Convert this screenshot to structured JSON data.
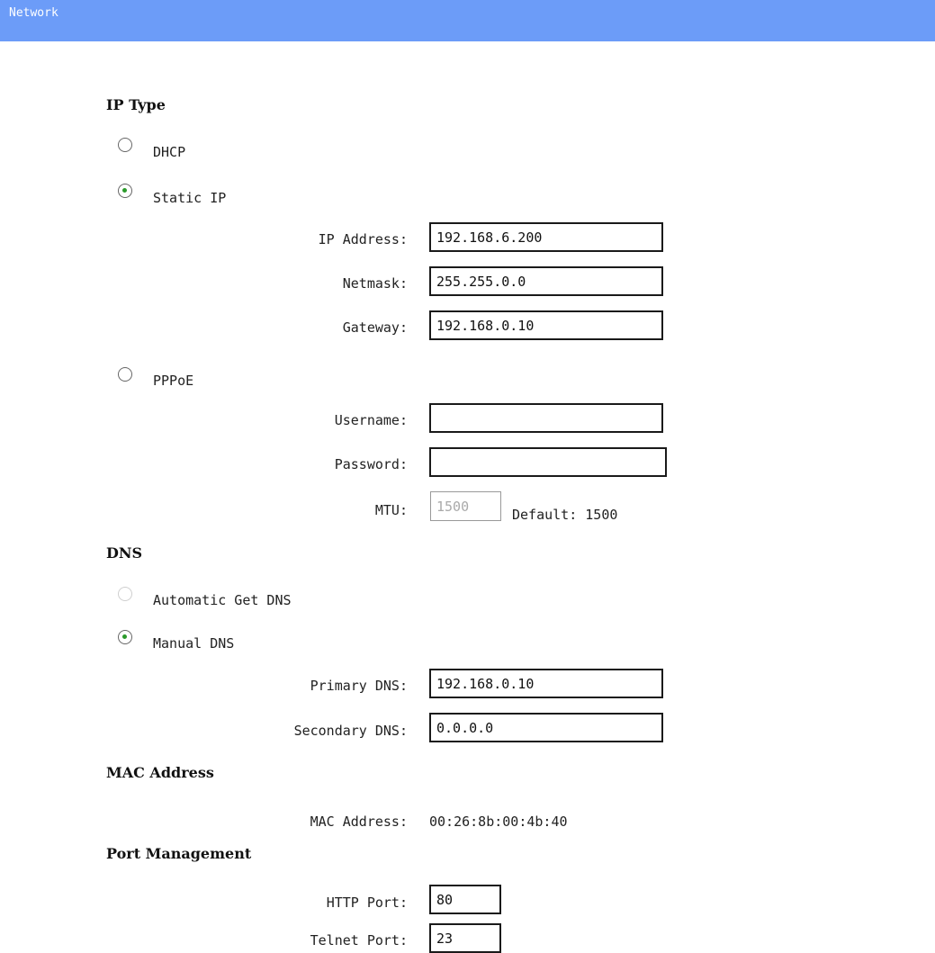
{
  "header": {
    "title": "Network"
  },
  "ip_type": {
    "heading": "IP Type",
    "dhcp": {
      "label": "DHCP",
      "checked": false
    },
    "static_ip": {
      "label": "Static IP",
      "checked": true,
      "ip_address": {
        "label": "IP Address:",
        "value": "192.168.6.200"
      },
      "netmask": {
        "label": "Netmask:",
        "value": "255.255.0.0"
      },
      "gateway": {
        "label": "Gateway:",
        "value": "192.168.0.10"
      }
    },
    "pppoe": {
      "label": "PPPoE",
      "checked": false,
      "username": {
        "label": "Username:",
        "value": ""
      },
      "password": {
        "label": "Password:",
        "value": ""
      },
      "mtu": {
        "label": "MTU:",
        "value": "1500",
        "default_text": "Default: 1500"
      }
    }
  },
  "dns": {
    "heading": "DNS",
    "automatic": {
      "label": "Automatic Get DNS",
      "checked": false,
      "disabled": true
    },
    "manual": {
      "label": "Manual DNS",
      "checked": true
    },
    "primary": {
      "label": "Primary DNS:",
      "value": "192.168.0.10"
    },
    "secondary": {
      "label": "Secondary DNS:",
      "value": "0.0.0.0"
    }
  },
  "mac": {
    "heading": "MAC Address",
    "label": "MAC Address:",
    "value": "00:26:8b:00:4b:40"
  },
  "ports": {
    "heading": "Port Management",
    "http": {
      "label": "HTTP Port:",
      "value": "80"
    },
    "telnet": {
      "label": "Telnet Port:",
      "value": "23"
    }
  },
  "colors": {
    "header_bg": "#6c9cf8",
    "radio_dot": "#2b9a2b"
  }
}
